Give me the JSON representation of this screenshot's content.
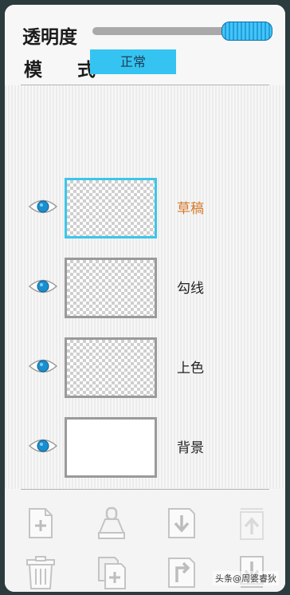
{
  "header": {
    "opacity_label": "透明度",
    "opacity_value_percent": 100,
    "mode_label": "模 式",
    "mode_value": "正常"
  },
  "layers": [
    {
      "name": "草稿",
      "visible": true,
      "selected": true,
      "thumbnail": "transparent"
    },
    {
      "name": "勾线",
      "visible": true,
      "selected": false,
      "thumbnail": "transparent"
    },
    {
      "name": "上色",
      "visible": true,
      "selected": false,
      "thumbnail": "transparent"
    },
    {
      "name": "背景",
      "visible": true,
      "selected": false,
      "thumbnail": "white"
    }
  ],
  "toolbar": {
    "row1": [
      "add-layer-icon",
      "clip-layer-icon",
      "merge-down-icon",
      "move-up-icon"
    ],
    "row2": [
      "trash-icon",
      "duplicate-layer-icon",
      "export-layer-icon",
      "move-down-icon"
    ]
  },
  "watermark": "头条@周婆睿狄",
  "colors": {
    "accent": "#35c4f1",
    "active_layer_text": "#d67a2c",
    "selected_border": "#3cc6ea",
    "background": "#2c3b3d"
  }
}
